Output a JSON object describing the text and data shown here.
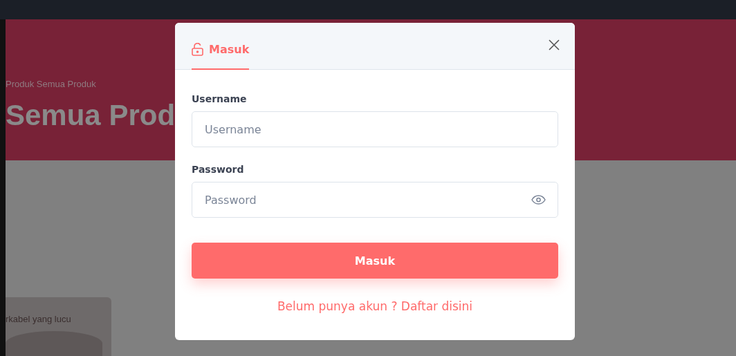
{
  "page": {
    "breadcrumb": "Produk Semua Produk",
    "title": "Semua Prod",
    "product_card": {
      "name": "rkabel yang lucu"
    }
  },
  "modal": {
    "tabs": [
      {
        "label": "Masuk",
        "selected": true
      }
    ],
    "fields": [
      {
        "label": "Username",
        "placeholder": "Username",
        "kind": "text"
      },
      {
        "label": "Password",
        "placeholder": "Password",
        "kind": "password"
      }
    ],
    "submit": "Masuk",
    "register_link": "Belum punya akun ? Daftar disini"
  }
}
